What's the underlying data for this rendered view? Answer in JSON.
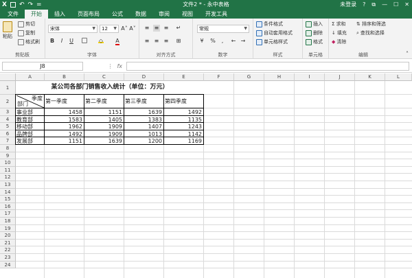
{
  "window": {
    "quick_access": {
      "save_icon": "save-icon",
      "undo_label": "↶",
      "redo_label": "↷",
      "menu_label": "="
    },
    "title": "文件2 * - 永中表格",
    "user": "未登录",
    "help_label": "?",
    "restore_label": "⧉",
    "minimize_label": "—",
    "maximize_label": "☐",
    "close_label": "✕"
  },
  "tabs": [
    "文件",
    "开始",
    "插入",
    "页面布局",
    "公式",
    "数据",
    "审阅",
    "视图",
    "开发工具"
  ],
  "active_tab": "开始",
  "ribbon": {
    "clipboard": {
      "label": "剪贴板",
      "paste": "粘贴",
      "cut": "剪切",
      "copy": "复制",
      "format_painter": "格式刷"
    },
    "font": {
      "label": "字体",
      "font_name": "宋体",
      "font_size": "12",
      "grow": "A˄",
      "shrink": "A˅",
      "bold": "B",
      "italic": "I",
      "underline": "U"
    },
    "alignment": {
      "label": "对齐方式"
    },
    "number": {
      "label": "数字",
      "format": "常规",
      "percent": "%",
      "comma": ","
    },
    "styles": {
      "label": "样式",
      "conditional": "条件格式",
      "table_style": "自动套用格式",
      "cell_style": "单元格样式"
    },
    "cells": {
      "label": "单元格",
      "insert": "插入",
      "delete": "删除",
      "format": "格式"
    },
    "editing": {
      "label": "编辑",
      "sum": "求和",
      "sort_filter": "排序和筛选",
      "fill": "填充",
      "find": "查找和选择",
      "clear": "清除"
    }
  },
  "formula_bar": {
    "name_box": "J8",
    "fx_label": "fx",
    "formula": ""
  },
  "columns": [
    "A",
    "B",
    "C",
    "D",
    "E",
    "F",
    "G",
    "H",
    "I",
    "J",
    "K",
    "L"
  ],
  "rows": [
    "1",
    "2",
    "3",
    "4",
    "5",
    "6",
    "7",
    "8",
    "9",
    "10",
    "11",
    "12",
    "13",
    "14",
    "15",
    "16",
    "17",
    "18",
    "19",
    "20",
    "21",
    "22",
    "23",
    "24"
  ],
  "sheet": {
    "title": "某公司各部门销售收入统计（单位：万元）",
    "corner_top": "季度",
    "corner_bottom": "部门",
    "quarters": [
      "第一季度",
      "第二季度",
      "第三季度",
      "第四季度"
    ],
    "departments": [
      {
        "name": "事业部",
        "values": [
          "1458",
          "1151",
          "1639",
          "1492"
        ]
      },
      {
        "name": "教育部",
        "values": [
          "1583",
          "1405",
          "1383",
          "1135"
        ]
      },
      {
        "name": "移动部",
        "values": [
          "1962",
          "1909",
          "1407",
          "1243"
        ]
      },
      {
        "name": "品牌部",
        "values": [
          "1492",
          "1909",
          "1013",
          "1142"
        ]
      },
      {
        "name": "发展部",
        "values": [
          "1151",
          "1639",
          "1200",
          "1169"
        ]
      }
    ]
  }
}
